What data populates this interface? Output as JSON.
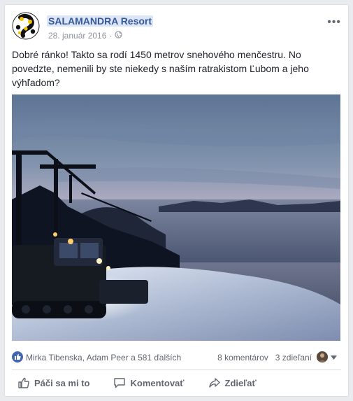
{
  "post": {
    "page_name": "SALAMANDRA Resort",
    "date": "28. január 2016",
    "separator": "·",
    "more_label": "•••",
    "text": "Dobré ránko! Takto sa rodí 1450 metrov snehového menčestru. No povedzte, nemenili by ste niekedy s naším ratrakistom Ľubom a jeho výhľadom?"
  },
  "reactions": {
    "names": "Mirka Tibenska, Adam Peer a 581 ďalších",
    "comments": "8 komentárov",
    "shares": "3 zdieľaní"
  },
  "actions": {
    "like": "Páči sa mi to",
    "comment": "Komentovať",
    "share": "Zdieľať"
  },
  "colors": {
    "link": "#365899",
    "accent": "#4267b2",
    "muted": "#606770"
  },
  "icons": {
    "avatar": "salamander-logo-icon",
    "audience": "globe-icon",
    "like_badge": "thumbs-up-icon",
    "like": "thumbs-up-outline-icon",
    "comment": "speech-bubble-icon",
    "share": "share-arrow-icon"
  }
}
